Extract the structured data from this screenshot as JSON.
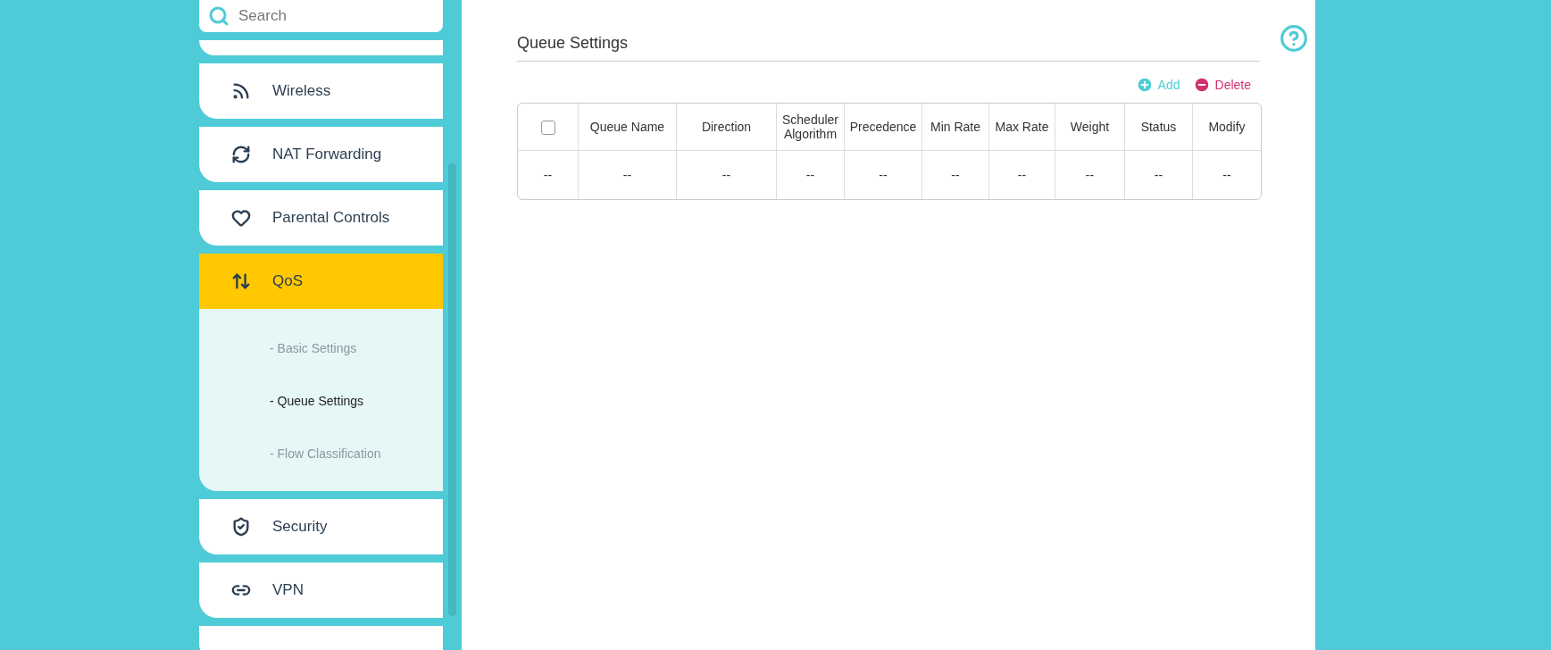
{
  "search": {
    "placeholder": "Search"
  },
  "menu": [
    {
      "label": "Wireless",
      "selected": false
    },
    {
      "label": "NAT Forwarding",
      "selected": false
    },
    {
      "label": "Parental Controls",
      "selected": false
    },
    {
      "label": "QoS",
      "selected": true,
      "expanded": true,
      "children": [
        {
          "label": "- Basic Settings",
          "selected": false
        },
        {
          "label": "- Queue Settings",
          "selected": true
        },
        {
          "label": "- Flow Classification",
          "selected": false
        }
      ]
    },
    {
      "label": "Security",
      "selected": false
    },
    {
      "label": "VPN",
      "selected": false
    }
  ],
  "page": {
    "title": "Queue Settings",
    "actions": [
      {
        "kind": "add",
        "label": "Add"
      },
      {
        "kind": "delete",
        "label": "Delete"
      }
    ],
    "table": {
      "columns": [
        {
          "kind": "checkbox",
          "checked": false
        },
        {
          "kind": "text",
          "label": "Queue Name"
        },
        {
          "kind": "text",
          "label": "Direction"
        },
        {
          "kind": "text",
          "label": "Scheduler Algorithm"
        },
        {
          "kind": "text",
          "label": "Precedence"
        },
        {
          "kind": "text",
          "label": "Min Rate"
        },
        {
          "kind": "text",
          "label": "Max Rate"
        },
        {
          "kind": "text",
          "label": "Weight"
        },
        {
          "kind": "text",
          "label": "Status"
        },
        {
          "kind": "text",
          "label": "Modify"
        }
      ],
      "rows": [
        [
          "--",
          "--",
          "--",
          "--",
          "--",
          "--",
          "--",
          "--",
          "--",
          "--"
        ]
      ]
    }
  }
}
